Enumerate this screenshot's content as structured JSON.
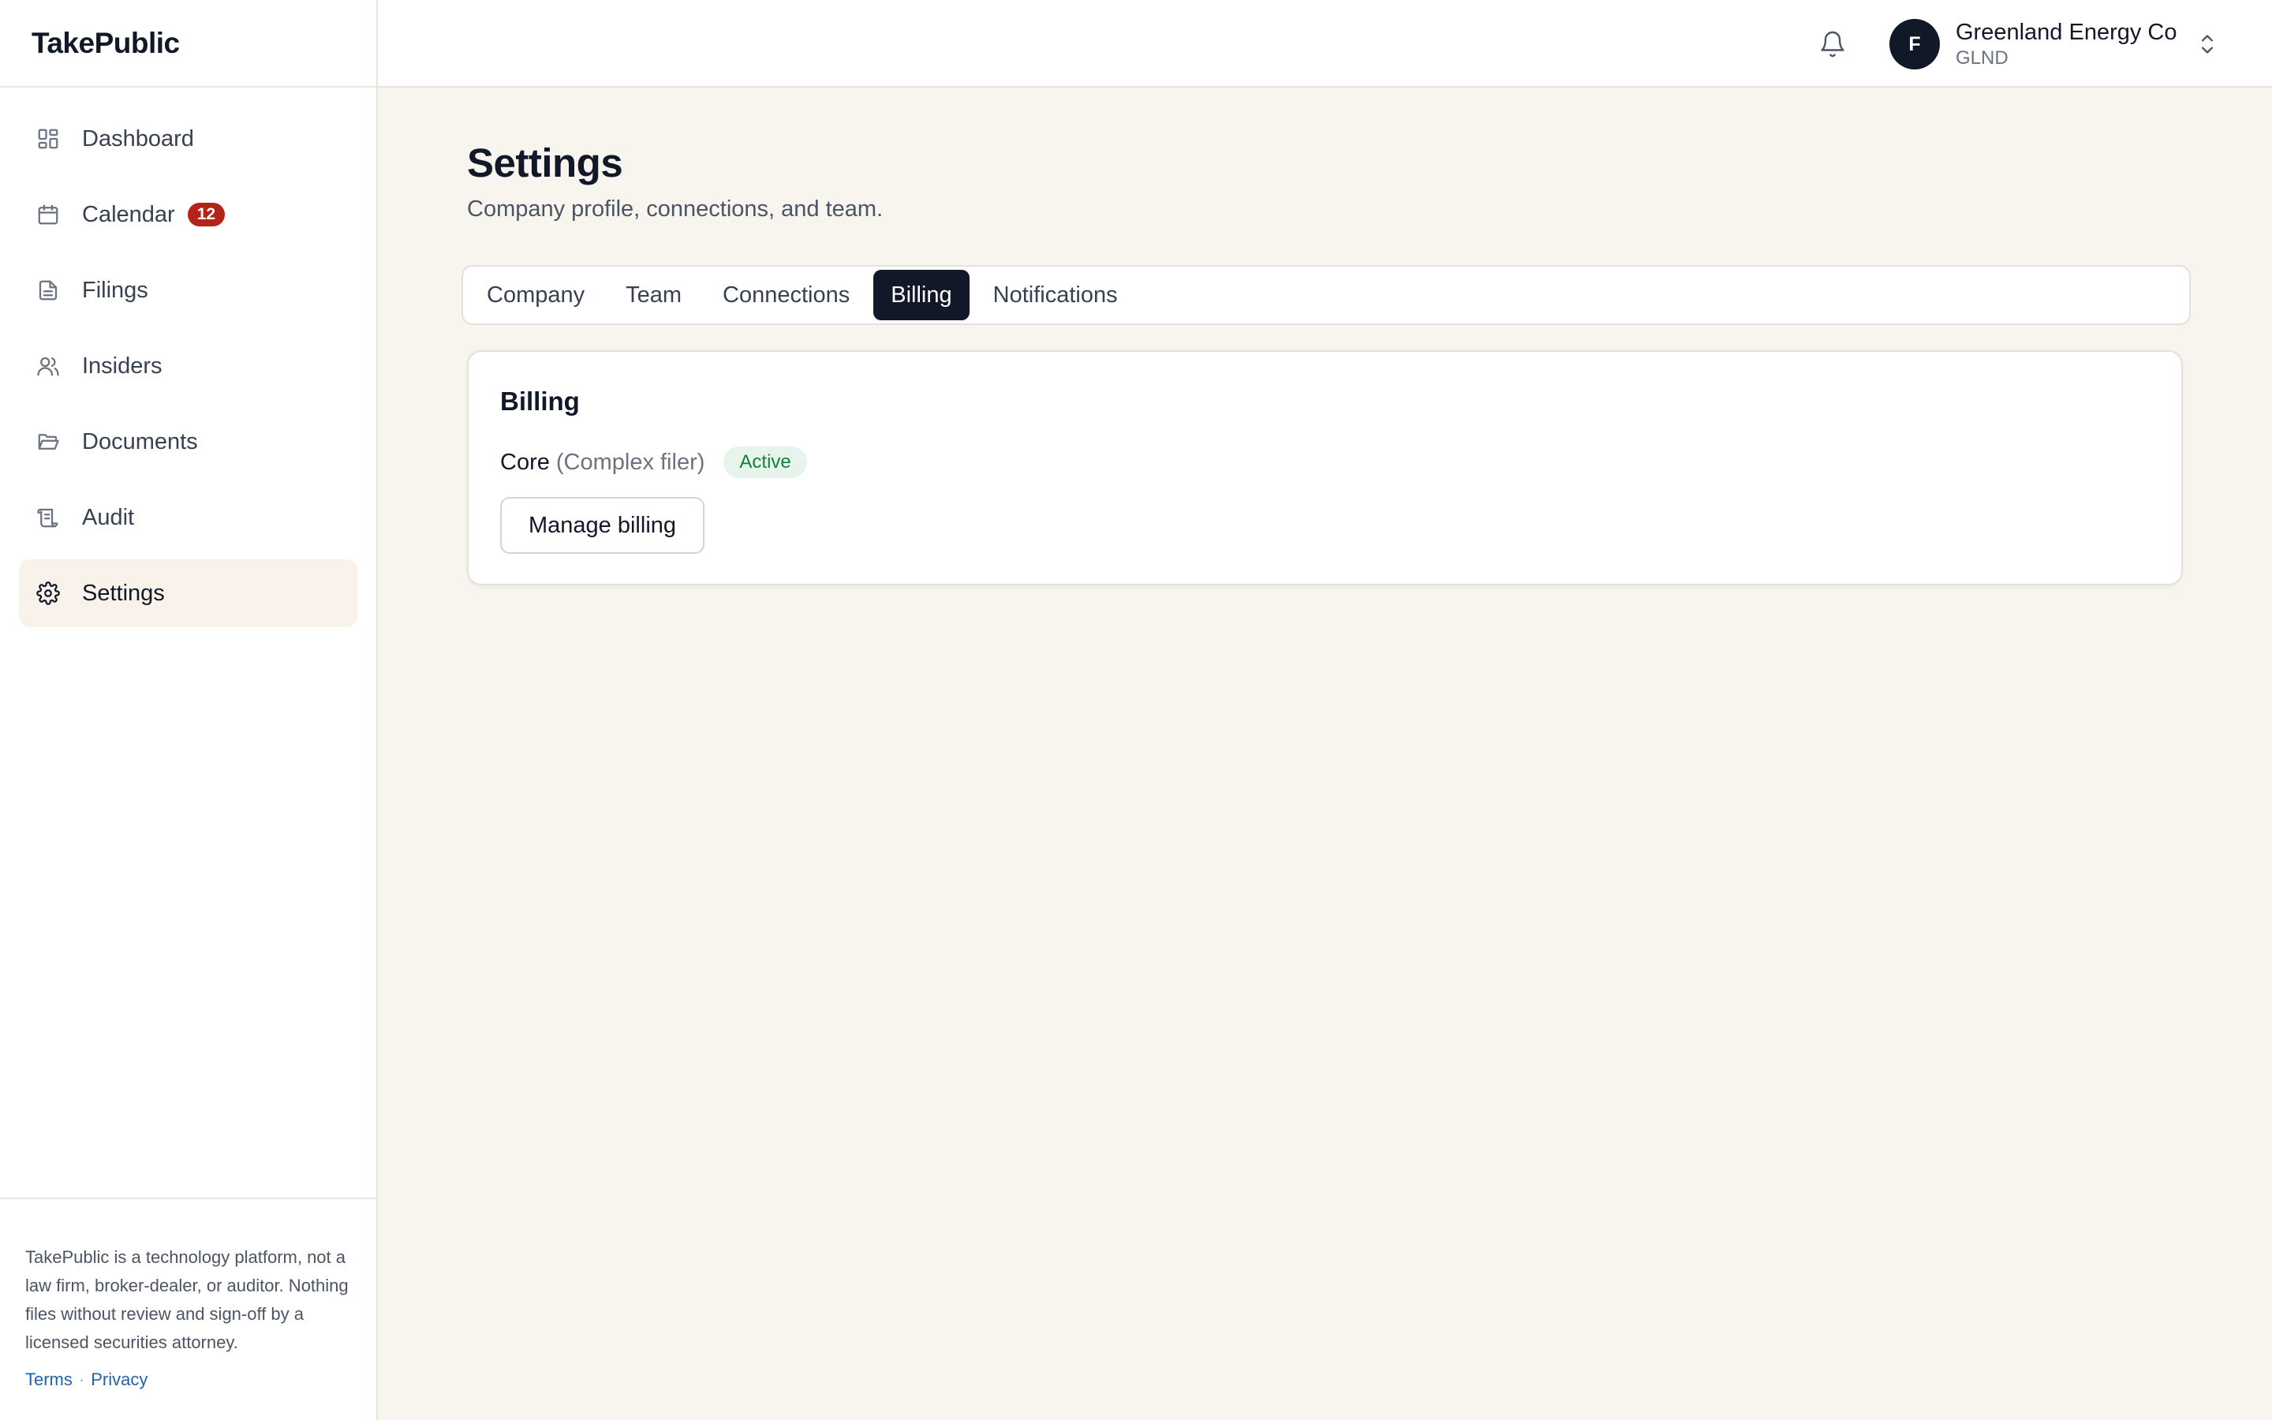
{
  "app": {
    "brand": "TakePublic"
  },
  "sidebar": {
    "items": [
      {
        "label": "Dashboard",
        "icon": "dashboard-icon"
      },
      {
        "label": "Calendar",
        "icon": "calendar-icon",
        "badge": "12"
      },
      {
        "label": "Filings",
        "icon": "file-text-icon"
      },
      {
        "label": "Insiders",
        "icon": "users-icon"
      },
      {
        "label": "Documents",
        "icon": "folder-open-icon"
      },
      {
        "label": "Audit",
        "icon": "scroll-icon"
      },
      {
        "label": "Settings",
        "icon": "gear-icon",
        "active": true
      }
    ],
    "disclaimer": "TakePublic is a technology platform, not a law firm, broker-dealer, or auditor. Nothing files without review and sign-off by a licensed securities attorney.",
    "links": {
      "terms": "Terms",
      "separator": "·",
      "privacy": "Privacy"
    }
  },
  "topbar": {
    "avatar_initial": "F",
    "org_name": "Greenland Energy Co",
    "org_ticker": "GLND"
  },
  "page": {
    "title": "Settings",
    "subtitle": "Company profile, connections, and team."
  },
  "tabs": [
    {
      "label": "Company"
    },
    {
      "label": "Team"
    },
    {
      "label": "Connections"
    },
    {
      "label": "Billing",
      "active": true
    },
    {
      "label": "Notifications"
    }
  ],
  "billing": {
    "title": "Billing",
    "plan_name": "Core",
    "plan_tier": "(Complex filer)",
    "status": "Active",
    "manage_label": "Manage billing"
  },
  "colors": {
    "background": "#f8f4ee",
    "accent_dark": "#111827",
    "badge_red": "#b42318",
    "status_green": "#15803d",
    "link_blue": "#2563a8"
  }
}
